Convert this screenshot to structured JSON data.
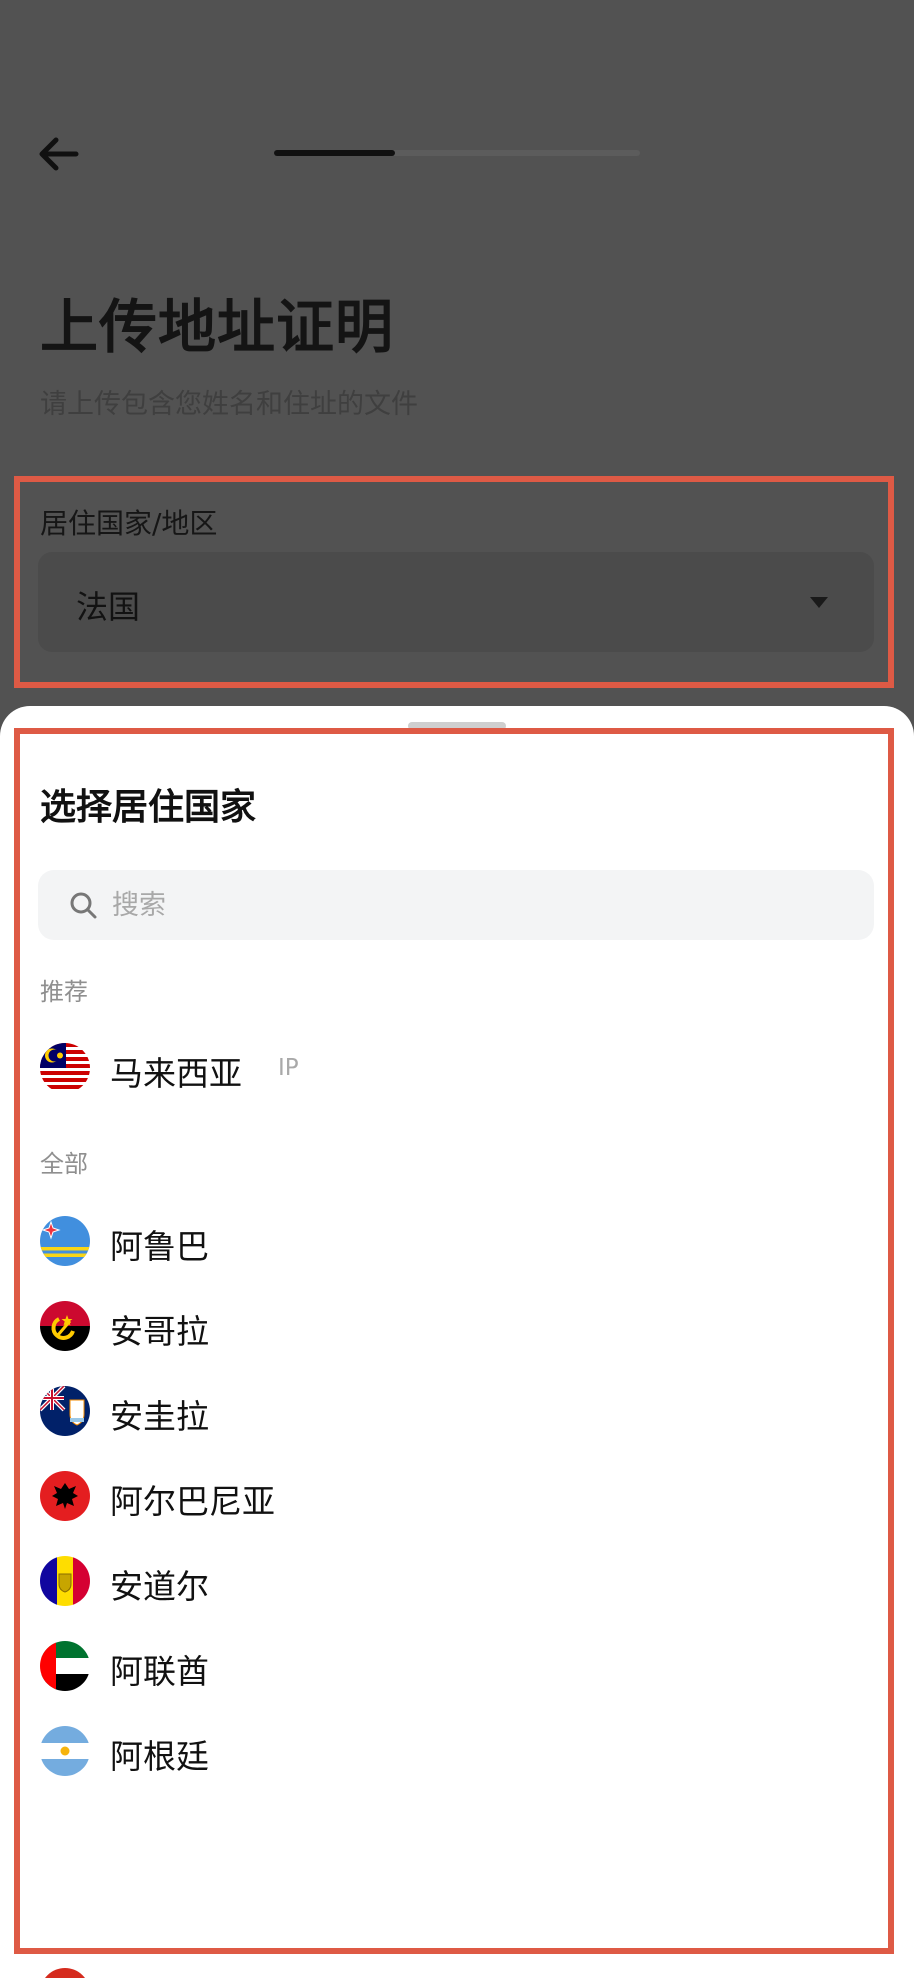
{
  "header": {
    "back_icon": "arrow-left-icon",
    "progress": 0.33
  },
  "page": {
    "title": "上传地址证明",
    "subtitle": "请上传包含您姓名和住址的文件"
  },
  "residence": {
    "label": "居住国家/地区",
    "value": "法国",
    "caret_icon": "caret-down-icon"
  },
  "sheet": {
    "title": "选择居住国家",
    "search": {
      "placeholder": "搜索",
      "value": ""
    },
    "recommended_label": "推荐",
    "recommended": [
      {
        "name": "马来西亚",
        "tag": "IP",
        "flag": "malaysia-flag-icon"
      }
    ],
    "all_label": "全部",
    "countries": [
      {
        "name": "阿鲁巴",
        "flag": "aruba-flag-icon"
      },
      {
        "name": "安哥拉",
        "flag": "angola-flag-icon"
      },
      {
        "name": "安圭拉",
        "flag": "anguilla-flag-icon"
      },
      {
        "name": "阿尔巴尼亚",
        "flag": "albania-flag-icon"
      },
      {
        "name": "安道尔",
        "flag": "andorra-flag-icon"
      },
      {
        "name": "阿联酋",
        "flag": "uae-flag-icon"
      },
      {
        "name": "阿根廷",
        "flag": "argentina-flag-icon"
      }
    ]
  },
  "colors": {
    "overlay": "#525252",
    "highlight": "#de5a45",
    "sheet_bg": "#ffffff",
    "search_bg": "#f3f4f5"
  }
}
